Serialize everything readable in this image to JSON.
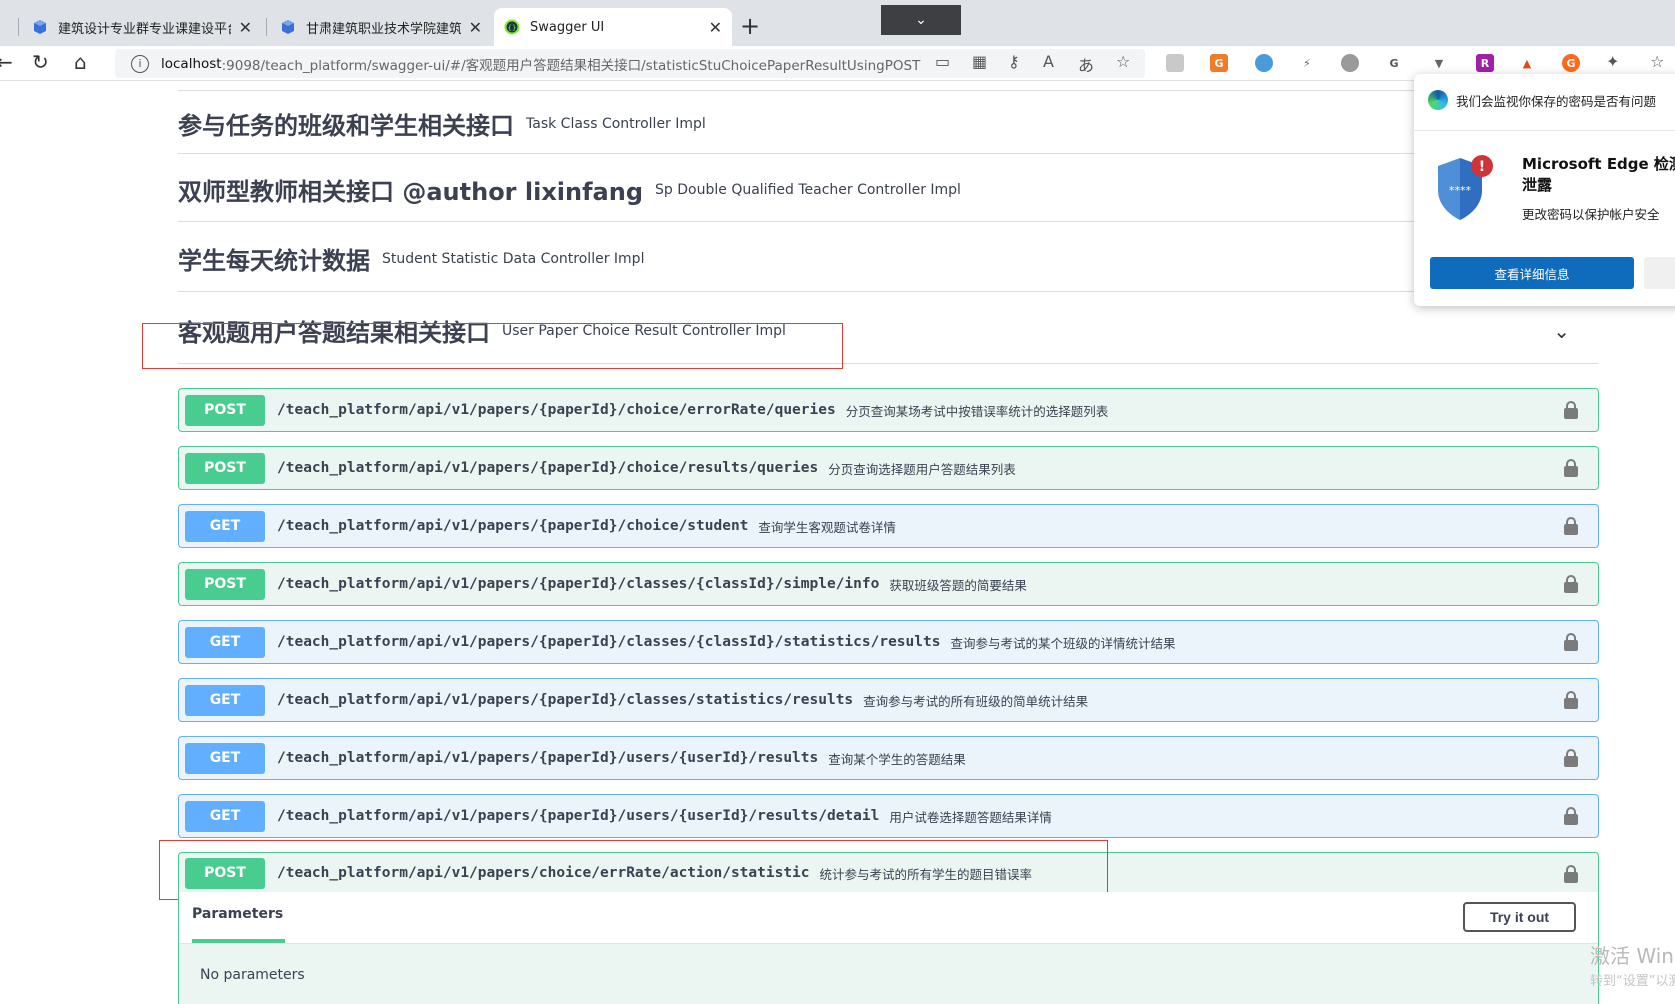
{
  "browser": {
    "tabs": [
      {
        "title": "建筑设计专业群专业课建设平台"
      },
      {
        "title": "甘肃建筑职业技术学院建筑设计专业群专业课建设平台"
      },
      {
        "title": "Swagger UI"
      }
    ],
    "url_host": "localhost",
    "url_path": ":9098/teach_platform/swagger-ui/#/客观题用户答题结果相关接口/statisticStuChoicePaperResultUsingPOST"
  },
  "tags": [
    {
      "name": "参与任务的班级和学生相关接口",
      "description": "Task Class Controller Impl"
    },
    {
      "name": "双师型教师相关接口 @author lixinfang",
      "description": "Sp Double Qualified Teacher Controller Impl"
    },
    {
      "name": "学生每天统计数据",
      "description": "Student Statistic Data Controller Impl"
    },
    {
      "name": "客观题用户答题结果相关接口",
      "description": "User Paper Choice Result Controller Impl"
    }
  ],
  "operations": [
    {
      "method": "POST",
      "path": "/teach_platform/api/v1/papers/{paperId}/choice/errorRate/queries",
      "summary": "分页查询某场考试中按错误率统计的选择题列表"
    },
    {
      "method": "POST",
      "path": "/teach_platform/api/v1/papers/{paperId}/choice/results/queries",
      "summary": "分页查询选择题用户答题结果列表"
    },
    {
      "method": "GET",
      "path": "/teach_platform/api/v1/papers/{paperId}/choice/student",
      "summary": "查询学生客观题试卷详情"
    },
    {
      "method": "POST",
      "path": "/teach_platform/api/v1/papers/{paperId}/classes/{classId}/simple/info",
      "summary": "获取班级答题的简要结果"
    },
    {
      "method": "GET",
      "path": "/teach_platform/api/v1/papers/{paperId}/classes/{classId}/statistics/results",
      "summary": "查询参与考试的某个班级的详情统计结果"
    },
    {
      "method": "GET",
      "path": "/teach_platform/api/v1/papers/{paperId}/classes/statistics/results",
      "summary": "查询参与考试的所有班级的简单统计结果"
    },
    {
      "method": "GET",
      "path": "/teach_platform/api/v1/papers/{paperId}/users/{userId}/results",
      "summary": "查询某个学生的答题结果"
    },
    {
      "method": "GET",
      "path": "/teach_platform/api/v1/papers/{paperId}/users/{userId}/results/detail",
      "summary": "用户试卷选择题答题结果详情"
    },
    {
      "method": "POST",
      "path": "/teach_platform/api/v1/papers/choice/errRate/action/statistic",
      "summary": "统计参与考试的所有学生的题目错误率"
    }
  ],
  "expanded": {
    "params_tab": "Parameters",
    "try_it_out": "Try it out",
    "no_params": "No parameters"
  },
  "popup": {
    "header": "我们会监视你保存的密码是否有问题",
    "title_line1": "Microsoft Edge 检测到",
    "title_line2": "泄露",
    "subtitle": "更改密码以保护帐户安全",
    "button": "查看详细信息"
  },
  "watermark": {
    "line1": "激活 Windows",
    "line2": "转到“设置”以激活"
  },
  "colors": {
    "post": "#49cc90",
    "get": "#61affe",
    "highlight": "#e53935"
  }
}
